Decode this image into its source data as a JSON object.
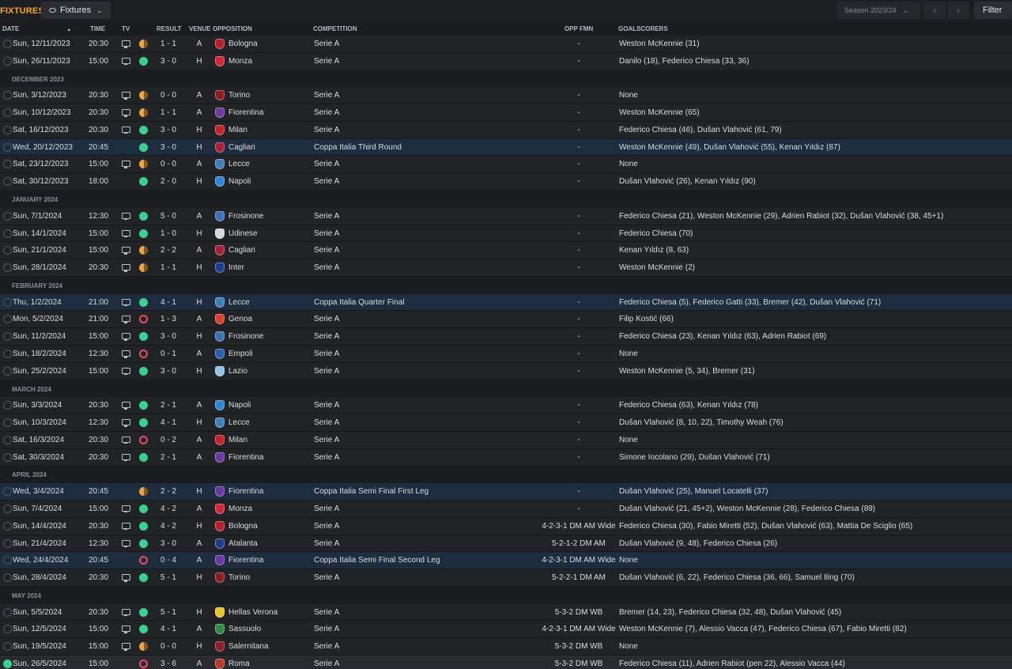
{
  "header": {
    "title": "FIXTURES",
    "view_label": "Fixtures",
    "season_label": "Season 2023/24",
    "prev_icon": "chevron-left-icon",
    "next_icon": "chevron-right-icon",
    "filter_label": "Filter"
  },
  "columns": {
    "date": "DATE",
    "time": "TIME",
    "tv": "TV",
    "result": "RESULT",
    "venue": "VENUE",
    "opposition": "OPPOSITION",
    "competition": "COMPETITION",
    "opp_fmn": "OPP FMN",
    "goalscorers": "GOALSCORERS"
  },
  "colors": {
    "title": "#f5a623",
    "win": "#3ecf8e",
    "draw": "#f2a33a",
    "loss": "#e8505b",
    "cup_row": "#1e2c3f"
  },
  "rows": [
    {
      "kind": "fixture",
      "date": "Sun, 12/11/2023",
      "time": "20:30",
      "tv": true,
      "outcome": "D",
      "result": "1 - 1",
      "venue": "A",
      "opposition": "Bologna",
      "crest": "#b5202b",
      "competition": "Serie A",
      "cup": false,
      "opp_fmn": "-",
      "scorers": "Weston McKennie (31)"
    },
    {
      "kind": "fixture",
      "date": "Sun, 26/11/2023",
      "time": "15:00",
      "tv": true,
      "outcome": "W",
      "result": "3 - 0",
      "venue": "H",
      "opposition": "Monza",
      "crest": "#d0263a",
      "competition": "Serie A",
      "cup": false,
      "opp_fmn": "-",
      "scorers": "Danilo (18), Federico Chiesa (33, 36)"
    },
    {
      "kind": "month",
      "label": "DECEMBER 2023"
    },
    {
      "kind": "fixture",
      "date": "Sun, 3/12/2023",
      "time": "20:30",
      "tv": true,
      "outcome": "D",
      "result": "0 - 0",
      "venue": "A",
      "opposition": "Torino",
      "crest": "#8a1c22",
      "competition": "Serie A",
      "cup": false,
      "opp_fmn": "-",
      "scorers": "None"
    },
    {
      "kind": "fixture",
      "date": "Sun, 10/12/2023",
      "time": "20:30",
      "tv": true,
      "outcome": "D",
      "result": "1 - 1",
      "venue": "A",
      "opposition": "Fiorentina",
      "crest": "#6b3aa0",
      "competition": "Serie A",
      "cup": false,
      "opp_fmn": "-",
      "scorers": "Weston McKennie (65)"
    },
    {
      "kind": "fixture",
      "date": "Sat, 16/12/2023",
      "time": "20:30",
      "tv": true,
      "outcome": "W",
      "result": "3 - 0",
      "venue": "H",
      "opposition": "Milan",
      "crest": "#c4232b",
      "competition": "Serie A",
      "cup": false,
      "opp_fmn": "-",
      "scorers": "Federico Chiesa (46), Dušan Vlahović (61, 79)"
    },
    {
      "kind": "fixture",
      "date": "Wed, 20/12/2023",
      "time": "20:45",
      "tv": false,
      "outcome": "W",
      "result": "3 - 0",
      "venue": "H",
      "opposition": "Cagliari",
      "crest": "#a8203a",
      "competition": "Coppa Italia Third Round",
      "cup": true,
      "opp_fmn": "-",
      "scorers": "Weston McKennie (49), Dušan Vlahović (55), Kenan Yıldız (87)"
    },
    {
      "kind": "fixture",
      "date": "Sat, 23/12/2023",
      "time": "15:00",
      "tv": true,
      "outcome": "D",
      "result": "0 - 0",
      "venue": "A",
      "opposition": "Lecce",
      "crest": "#3f7fb8",
      "competition": "Serie A",
      "cup": false,
      "opp_fmn": "-",
      "scorers": "None"
    },
    {
      "kind": "fixture",
      "date": "Sat, 30/12/2023",
      "time": "18:00",
      "tv": false,
      "outcome": "W",
      "result": "2 - 0",
      "venue": "H",
      "opposition": "Napoli",
      "crest": "#2f86d6",
      "competition": "Serie A",
      "cup": false,
      "opp_fmn": "-",
      "scorers": "Dušan Vlahović (26), Kenan Yıldız (90)"
    },
    {
      "kind": "month",
      "label": "JANUARY 2024"
    },
    {
      "kind": "fixture",
      "date": "Sun, 7/1/2024",
      "time": "12:30",
      "tv": true,
      "outcome": "W",
      "result": "5 - 0",
      "venue": "A",
      "opposition": "Frosinone",
      "crest": "#3a72b8",
      "competition": "Serie A",
      "cup": false,
      "opp_fmn": "-",
      "scorers": "Federico Chiesa (21), Weston McKennie (29), Adrien Rabiot (32), Dušan Vlahović (38, 45+1)"
    },
    {
      "kind": "fixture",
      "date": "Sun, 14/1/2024",
      "time": "15:00",
      "tv": true,
      "outcome": "W",
      "result": "1 - 0",
      "venue": "H",
      "opposition": "Udinese",
      "crest": "#d8d8d8",
      "competition": "Serie A",
      "cup": false,
      "opp_fmn": "-",
      "scorers": "Federico Chiesa (70)"
    },
    {
      "kind": "fixture",
      "date": "Sun, 21/1/2024",
      "time": "15:00",
      "tv": true,
      "outcome": "D",
      "result": "2 - 2",
      "venue": "A",
      "opposition": "Cagliari",
      "crest": "#a8203a",
      "competition": "Serie A",
      "cup": false,
      "opp_fmn": "-",
      "scorers": "Kenan Yıldız (8, 63)"
    },
    {
      "kind": "fixture",
      "date": "Sun, 28/1/2024",
      "time": "20:30",
      "tv": true,
      "outcome": "D",
      "result": "1 - 1",
      "venue": "H",
      "opposition": "Inter",
      "crest": "#1c3d8f",
      "competition": "Serie A",
      "cup": false,
      "opp_fmn": "-",
      "scorers": "Weston McKennie (2)"
    },
    {
      "kind": "month",
      "label": "FEBRUARY 2024"
    },
    {
      "kind": "fixture",
      "date": "Thu, 1/2/2024",
      "time": "21:00",
      "tv": true,
      "outcome": "W",
      "result": "4 - 1",
      "venue": "H",
      "opposition": "Lecce",
      "crest": "#3f7fb8",
      "competition": "Coppa Italia Quarter Final",
      "cup": true,
      "opp_fmn": "-",
      "scorers": "Federico Chiesa (5), Federico Gatti (33), Bremer (42), Dušan Vlahović (71)"
    },
    {
      "kind": "fixture",
      "date": "Mon, 5/2/2024",
      "time": "21:00",
      "tv": true,
      "outcome": "L",
      "result": "1 - 3",
      "venue": "A",
      "opposition": "Genoa",
      "crest": "#d4402b",
      "competition": "Serie A",
      "cup": false,
      "opp_fmn": "-",
      "scorers": "Filip Kostić (66)"
    },
    {
      "kind": "fixture",
      "date": "Sun, 11/2/2024",
      "time": "15:00",
      "tv": true,
      "outcome": "W",
      "result": "3 - 0",
      "venue": "H",
      "opposition": "Frosinone",
      "crest": "#3a72b8",
      "competition": "Serie A",
      "cup": false,
      "opp_fmn": "-",
      "scorers": "Federico Chiesa (23), Kenan Yıldız (63), Adrien Rabiot (69)"
    },
    {
      "kind": "fixture",
      "date": "Sun, 18/2/2024",
      "time": "12:30",
      "tv": true,
      "outcome": "L",
      "result": "0 - 1",
      "venue": "A",
      "opposition": "Empoli",
      "crest": "#2a5fb0",
      "competition": "Serie A",
      "cup": false,
      "opp_fmn": "-",
      "scorers": "None"
    },
    {
      "kind": "fixture",
      "date": "Sun, 25/2/2024",
      "time": "15:00",
      "tv": true,
      "outcome": "W",
      "result": "3 - 0",
      "venue": "H",
      "opposition": "Lazio",
      "crest": "#8fc3e8",
      "competition": "Serie A",
      "cup": false,
      "opp_fmn": "-",
      "scorers": "Weston McKennie (5, 34), Bremer (31)"
    },
    {
      "kind": "month",
      "label": "MARCH 2024"
    },
    {
      "kind": "fixture",
      "date": "Sun, 3/3/2024",
      "time": "20:30",
      "tv": true,
      "outcome": "W",
      "result": "2 - 1",
      "venue": "A",
      "opposition": "Napoli",
      "crest": "#2f86d6",
      "competition": "Serie A",
      "cup": false,
      "opp_fmn": "-",
      "scorers": "Federico Chiesa (63), Kenan Yıldız (78)"
    },
    {
      "kind": "fixture",
      "date": "Sun, 10/3/2024",
      "time": "12:30",
      "tv": true,
      "outcome": "W",
      "result": "4 - 1",
      "venue": "H",
      "opposition": "Lecce",
      "crest": "#3f7fb8",
      "competition": "Serie A",
      "cup": false,
      "opp_fmn": "-",
      "scorers": "Dušan Vlahović (8, 10, 22), Timothy Weah (76)"
    },
    {
      "kind": "fixture",
      "date": "Sat, 16/3/2024",
      "time": "20:30",
      "tv": true,
      "outcome": "L",
      "result": "0 - 2",
      "venue": "A",
      "opposition": "Milan",
      "crest": "#c4232b",
      "competition": "Serie A",
      "cup": false,
      "opp_fmn": "-",
      "scorers": "None"
    },
    {
      "kind": "fixture",
      "date": "Sat, 30/3/2024",
      "time": "20:30",
      "tv": true,
      "outcome": "W",
      "result": "2 - 1",
      "venue": "A",
      "opposition": "Fiorentina",
      "crest": "#6b3aa0",
      "competition": "Serie A",
      "cup": false,
      "opp_fmn": "-",
      "scorers": "Simone Iocolano (29), Dušan Vlahović (71)"
    },
    {
      "kind": "month",
      "label": "APRIL 2024"
    },
    {
      "kind": "fixture",
      "date": "Wed, 3/4/2024",
      "time": "20:45",
      "tv": false,
      "outcome": "D",
      "result": "2 - 2",
      "venue": "H",
      "opposition": "Fiorentina",
      "crest": "#6b3aa0",
      "competition": "Coppa Italia Semi Final First Leg",
      "cup": true,
      "opp_fmn": "-",
      "scorers": "Dušan Vlahović (25), Manuel Locatelli (37)"
    },
    {
      "kind": "fixture",
      "date": "Sun, 7/4/2024",
      "time": "15:00",
      "tv": true,
      "outcome": "W",
      "result": "4 - 2",
      "venue": "A",
      "opposition": "Monza",
      "crest": "#d0263a",
      "competition": "Serie A",
      "cup": false,
      "opp_fmn": "-",
      "scorers": "Dušan Vlahović (21, 45+2), Weston McKennie (28), Federico Chiesa (89)"
    },
    {
      "kind": "fixture",
      "date": "Sun, 14/4/2024",
      "time": "20:30",
      "tv": true,
      "outcome": "W",
      "result": "4 - 2",
      "venue": "H",
      "opposition": "Bologna",
      "crest": "#b5202b",
      "competition": "Serie A",
      "cup": false,
      "opp_fmn": "4-2-3-1 DM AM Wide",
      "scorers": "Federico Chiesa (30), Fabio Miretti (52), Dušan Vlahović (63), Mattia De Sciglio (65)"
    },
    {
      "kind": "fixture",
      "date": "Sun, 21/4/2024",
      "time": "12:30",
      "tv": true,
      "outcome": "W",
      "result": "3 - 0",
      "venue": "A",
      "opposition": "Atalanta",
      "crest": "#1d3f8a",
      "competition": "Serie A",
      "cup": false,
      "opp_fmn": "5-2-1-2 DM AM",
      "scorers": "Dušan Vlahović (9, 48), Federico Chiesa (26)"
    },
    {
      "kind": "fixture",
      "date": "Wed, 24/4/2024",
      "time": "20:45",
      "tv": false,
      "outcome": "L",
      "result": "0 - 4",
      "venue": "A",
      "opposition": "Fiorentina",
      "crest": "#6b3aa0",
      "competition": "Coppa Italia Semi Final Second Leg",
      "cup": true,
      "opp_fmn": "4-2-3-1 DM AM Wide",
      "scorers": "None"
    },
    {
      "kind": "fixture",
      "date": "Sun, 28/4/2024",
      "time": "20:30",
      "tv": true,
      "outcome": "W",
      "result": "5 - 1",
      "venue": "H",
      "opposition": "Torino",
      "crest": "#8a1c22",
      "competition": "Serie A",
      "cup": false,
      "opp_fmn": "5-2-2-1 DM AM",
      "scorers": "Dušan Vlahović (6, 22), Federico Chiesa (36, 66), Samuel Iling (70)"
    },
    {
      "kind": "month",
      "label": "MAY 2024"
    },
    {
      "kind": "fixture",
      "date": "Sun, 5/5/2024",
      "time": "20:30",
      "tv": true,
      "outcome": "W",
      "result": "5 - 1",
      "venue": "H",
      "opposition": "Hellas Verona",
      "crest": "#e8c52a",
      "competition": "Serie A",
      "cup": false,
      "opp_fmn": "5-3-2 DM WB",
      "scorers": "Bremer (14, 23), Federico Chiesa (32, 48), Dušan Vlahović (45)"
    },
    {
      "kind": "fixture",
      "date": "Sun, 12/5/2024",
      "time": "15:00",
      "tv": true,
      "outcome": "W",
      "result": "4 - 1",
      "venue": "A",
      "opposition": "Sassuolo",
      "crest": "#2e8a4a",
      "competition": "Serie A",
      "cup": false,
      "opp_fmn": "4-2-3-1 DM AM Wide",
      "scorers": "Weston McKennie (7), Alessio Vacca (47), Federico Chiesa (67), Fabio Miretti (82)"
    },
    {
      "kind": "fixture",
      "date": "Sun, 19/5/2024",
      "time": "15:00",
      "tv": true,
      "outcome": "D",
      "result": "0 - 0",
      "venue": "H",
      "opposition": "Salernitana",
      "crest": "#8c1f2a",
      "competition": "Serie A",
      "cup": false,
      "opp_fmn": "5-3-2 DM WB",
      "scorers": "None"
    },
    {
      "kind": "fixture",
      "date": "Sun, 26/5/2024",
      "time": "15:00",
      "tv": false,
      "outcome": "L",
      "result": "3 - 6",
      "venue": "A",
      "opposition": "Roma",
      "crest": "#b8392a",
      "competition": "Serie A",
      "cup": false,
      "current": true,
      "opp_fmn": "5-3-2 DM WB",
      "scorers": "Federico Chiesa (11), Adrien Rabiot (pen 22), Alessio Vacca (44)"
    }
  ]
}
